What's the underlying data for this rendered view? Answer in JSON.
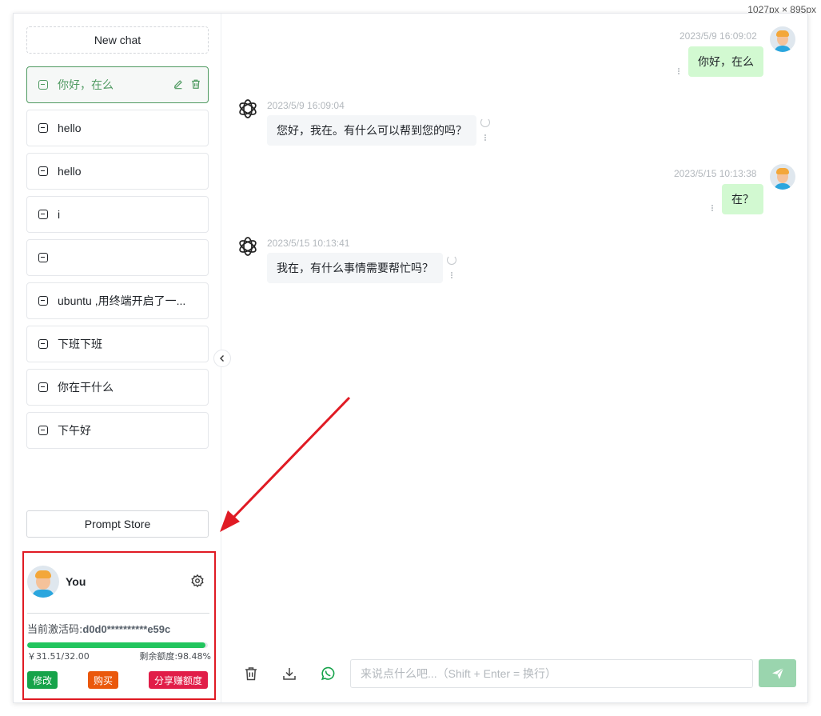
{
  "dimension_label": "1027px × 895px",
  "sidebar": {
    "new_chat": "New chat",
    "history": [
      {
        "label": "你好，在么",
        "active": true
      },
      {
        "label": "hello",
        "active": false
      },
      {
        "label": "hello",
        "active": false
      },
      {
        "label": "i",
        "active": false
      },
      {
        "label": "",
        "active": false
      },
      {
        "label": "ubuntu ,用终端开启了一...",
        "active": false
      },
      {
        "label": "下班下班",
        "active": false
      },
      {
        "label": "你在干什么",
        "active": false
      },
      {
        "label": "下午好",
        "active": false
      }
    ],
    "prompt_store": "Prompt Store"
  },
  "user": {
    "name": "You",
    "code_label": "当前激活码:",
    "code_value": "d0d0**********e59c",
    "quota_fraction": 0.9848,
    "used": "￥31.51/32.00",
    "remaining": "剩余额度:98.48%",
    "edit": "修改",
    "buy": "购买",
    "share": "分享赚额度"
  },
  "messages": [
    {
      "role": "user",
      "time": "2023/5/9 16:09:02",
      "text": "你好，在么"
    },
    {
      "role": "assistant",
      "time": "2023/5/9 16:09:04",
      "text": "您好，我在。有什么可以帮到您的吗？"
    },
    {
      "role": "user",
      "time": "2023/5/15 10:13:38",
      "text": "在？"
    },
    {
      "role": "assistant",
      "time": "2023/5/15 10:13:41",
      "text": "我在，有什么事情需要帮忙吗？"
    }
  ],
  "input": {
    "placeholder": "来说点什么吧...（Shift + Enter = 换行）",
    "value": ""
  },
  "colors": {
    "accent": "#4f9a61",
    "user_bubble": "#d2f9d1",
    "bot_bubble": "#f4f6f8",
    "highlight": "#e01b24",
    "send_button": "#9ad5ae"
  },
  "icons": {
    "history_item": "message-square-icon",
    "edit": "pencil-icon",
    "delete": "trash-icon",
    "settings": "gear-icon",
    "collapse": "chevron-left-icon",
    "clear": "trash-icon",
    "download": "download-icon",
    "whatsapp": "whatsapp-icon",
    "send": "send-icon",
    "bot_avatar": "openai-logo-icon"
  }
}
